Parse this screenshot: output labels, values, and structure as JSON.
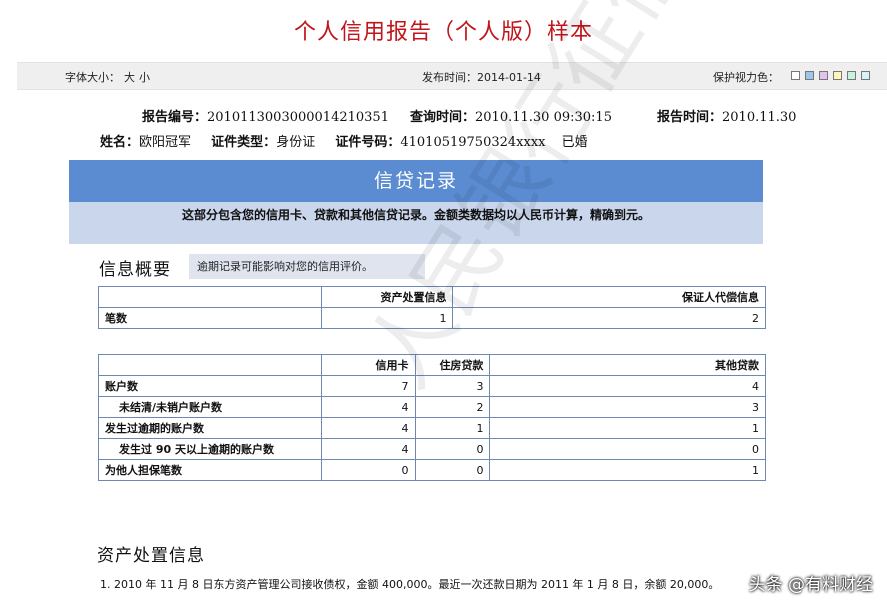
{
  "title": "个人信用报告（个人版）样本",
  "toolbar": {
    "font_size_label": "字体大小：",
    "font_large": "大",
    "font_small": "小",
    "published": "发布时间：2014-01-14",
    "eye_protect": "保护视力色："
  },
  "swatch_colors": [
    "#ffffff",
    "#9fc4f0",
    "#e3c2f2",
    "#fff7b8",
    "#c9f2dc",
    "#d6f2fb"
  ],
  "report": {
    "number_label": "报告编号：",
    "number": "2010113003000014210351",
    "query_label": "查询时间：",
    "query_time": "2010.11.30 09:30:15",
    "report_label": "报告时间：",
    "report_time": "2010.11.30",
    "name_label": "姓名：",
    "name": "欧阳冠军",
    "id_type_label": "证件类型：",
    "id_type": "身份证",
    "id_no_label": "证件号码：",
    "id_no": "41010519750324xxxx",
    "marital": "已婚"
  },
  "banner": {
    "title": "信贷记录",
    "desc": "这部分包含您的信用卡、贷款和其他信贷记录。金额类数据均以人民币计算，精确到元。"
  },
  "overview": {
    "title": "信息概要",
    "note": "逾期记录可能影响对您的信用评价。"
  },
  "table1": {
    "headers": [
      "",
      "资产处置信息",
      "保证人代偿信息"
    ],
    "row": {
      "label": "笔数",
      "values": [
        "1",
        "2"
      ]
    }
  },
  "table2": {
    "headers": [
      "",
      "信用卡",
      "住房贷款",
      "其他贷款"
    ],
    "rows": [
      {
        "label": "账户数",
        "values": [
          "7",
          "3",
          "4"
        ]
      },
      {
        "label": "未结清/未销户账户数",
        "values": [
          "4",
          "2",
          "3"
        ]
      },
      {
        "label": "发生过逾期的账户数",
        "values": [
          "4",
          "1",
          "1"
        ]
      },
      {
        "label": "发生过 90 天以上逾期的账户数",
        "values": [
          "4",
          "0",
          "0"
        ]
      },
      {
        "label": "为他人担保笔数",
        "values": [
          "0",
          "0",
          "1"
        ]
      }
    ]
  },
  "asset": {
    "title": "资产处置信息",
    "items": [
      "1.  2010 年 11 月 8 日东方资产管理公司接收债权，金额 400,000。最近一次还款日期为 2011 年 1 月 8 日，余额 20,000。"
    ]
  },
  "watermark": "人民银行征信中心",
  "credit": "头条 @有料财经"
}
